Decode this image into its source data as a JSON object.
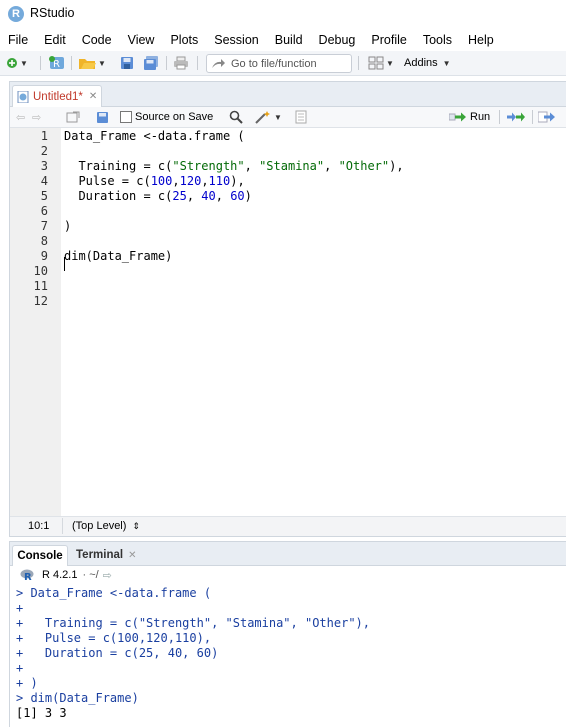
{
  "window": {
    "title": "RStudio",
    "icon_letter": "R"
  },
  "menu": [
    "File",
    "Edit",
    "Code",
    "View",
    "Plots",
    "Session",
    "Build",
    "Debug",
    "Profile",
    "Tools",
    "Help"
  ],
  "toolbar": {
    "goto_placeholder": "Go to file/function",
    "addins_label": "Addins"
  },
  "editor": {
    "tab_label": "Untitled1*",
    "source_on_save_label": "Source on Save",
    "run_label": "Run",
    "line_numbers": [
      "1",
      "2",
      "3",
      "4",
      "5",
      "6",
      "7",
      "8",
      "9",
      "10",
      "11",
      "12"
    ],
    "lines": [
      [
        {
          "t": "Data_Frame <-data.frame (",
          "c": ""
        }
      ],
      [],
      [
        {
          "t": "  Training = c(",
          "c": ""
        },
        {
          "t": "\"Strength\"",
          "c": "str"
        },
        {
          "t": ", ",
          "c": ""
        },
        {
          "t": "\"Stamina\"",
          "c": "str"
        },
        {
          "t": ", ",
          "c": ""
        },
        {
          "t": "\"Other\"",
          "c": "str"
        },
        {
          "t": "),",
          "c": ""
        }
      ],
      [
        {
          "t": "  Pulse = c(",
          "c": ""
        },
        {
          "t": "100",
          "c": "num"
        },
        {
          "t": ",",
          "c": ""
        },
        {
          "t": "120",
          "c": "num"
        },
        {
          "t": ",",
          "c": ""
        },
        {
          "t": "110",
          "c": "num"
        },
        {
          "t": "),",
          "c": ""
        }
      ],
      [
        {
          "t": "  Duration = c(",
          "c": ""
        },
        {
          "t": "25",
          "c": "num"
        },
        {
          "t": ", ",
          "c": ""
        },
        {
          "t": "40",
          "c": "num"
        },
        {
          "t": ", ",
          "c": ""
        },
        {
          "t": "60",
          "c": "num"
        },
        {
          "t": ")",
          "c": ""
        }
      ],
      [],
      [
        {
          "t": ")",
          "c": ""
        }
      ],
      [],
      [
        {
          "t": "dim(Data_Frame)",
          "c": ""
        }
      ],
      [],
      [],
      []
    ],
    "status_position": "10:1",
    "status_scope": "(Top Level)"
  },
  "console": {
    "tab_console": "Console",
    "tab_terminal": "Terminal",
    "r_version": "R 4.2.1",
    "path": "· ~/",
    "lines": [
      {
        "t": "> Data_Frame <-data.frame (",
        "out": false
      },
      {
        "t": "+",
        "out": false
      },
      {
        "t": "+   Training = c(\"Strength\", \"Stamina\", \"Other\"),",
        "out": false
      },
      {
        "t": "+   Pulse = c(100,120,110),",
        "out": false
      },
      {
        "t": "+   Duration = c(25, 40, 60)",
        "out": false
      },
      {
        "t": "+",
        "out": false
      },
      {
        "t": "+ )",
        "out": false
      },
      {
        "t": "> dim(Data_Frame)",
        "out": false
      },
      {
        "t": "[1] 3 3",
        "out": true
      }
    ]
  },
  "colors": {
    "accent": "#75aadb",
    "string": "#036a07",
    "number": "#0000cd",
    "modified_tab": "#c0392b"
  }
}
